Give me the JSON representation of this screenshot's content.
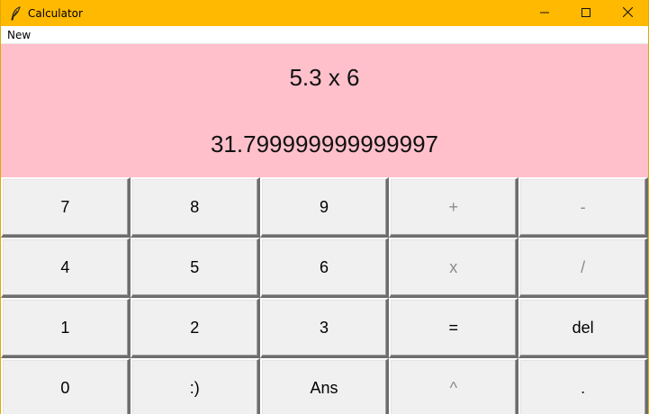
{
  "window": {
    "title": "Calculator",
    "icon": "feather-icon",
    "controls": [
      "minimize-icon",
      "maximize-icon",
      "close-icon"
    ],
    "titlebar_color": "#ffb900"
  },
  "menu": {
    "items": [
      {
        "label": "New"
      }
    ]
  },
  "display": {
    "expression": "5.3 x 6",
    "result": "31.799999999999997",
    "background": "#ffc0cb"
  },
  "keypad": {
    "rows": [
      [
        {
          "label": "7"
        },
        {
          "label": "8"
        },
        {
          "label": "9"
        },
        {
          "label": "+"
        },
        {
          "label": "-"
        }
      ],
      [
        {
          "label": "4"
        },
        {
          "label": "5"
        },
        {
          "label": "6"
        },
        {
          "label": "x"
        },
        {
          "label": "/"
        }
      ],
      [
        {
          "label": "1"
        },
        {
          "label": "2"
        },
        {
          "label": "3"
        },
        {
          "label": "="
        },
        {
          "label": "del"
        }
      ],
      [
        {
          "label": "0"
        },
        {
          "label": ":)"
        },
        {
          "label": "Ans"
        },
        {
          "label": "^"
        },
        {
          "label": "."
        }
      ]
    ]
  }
}
